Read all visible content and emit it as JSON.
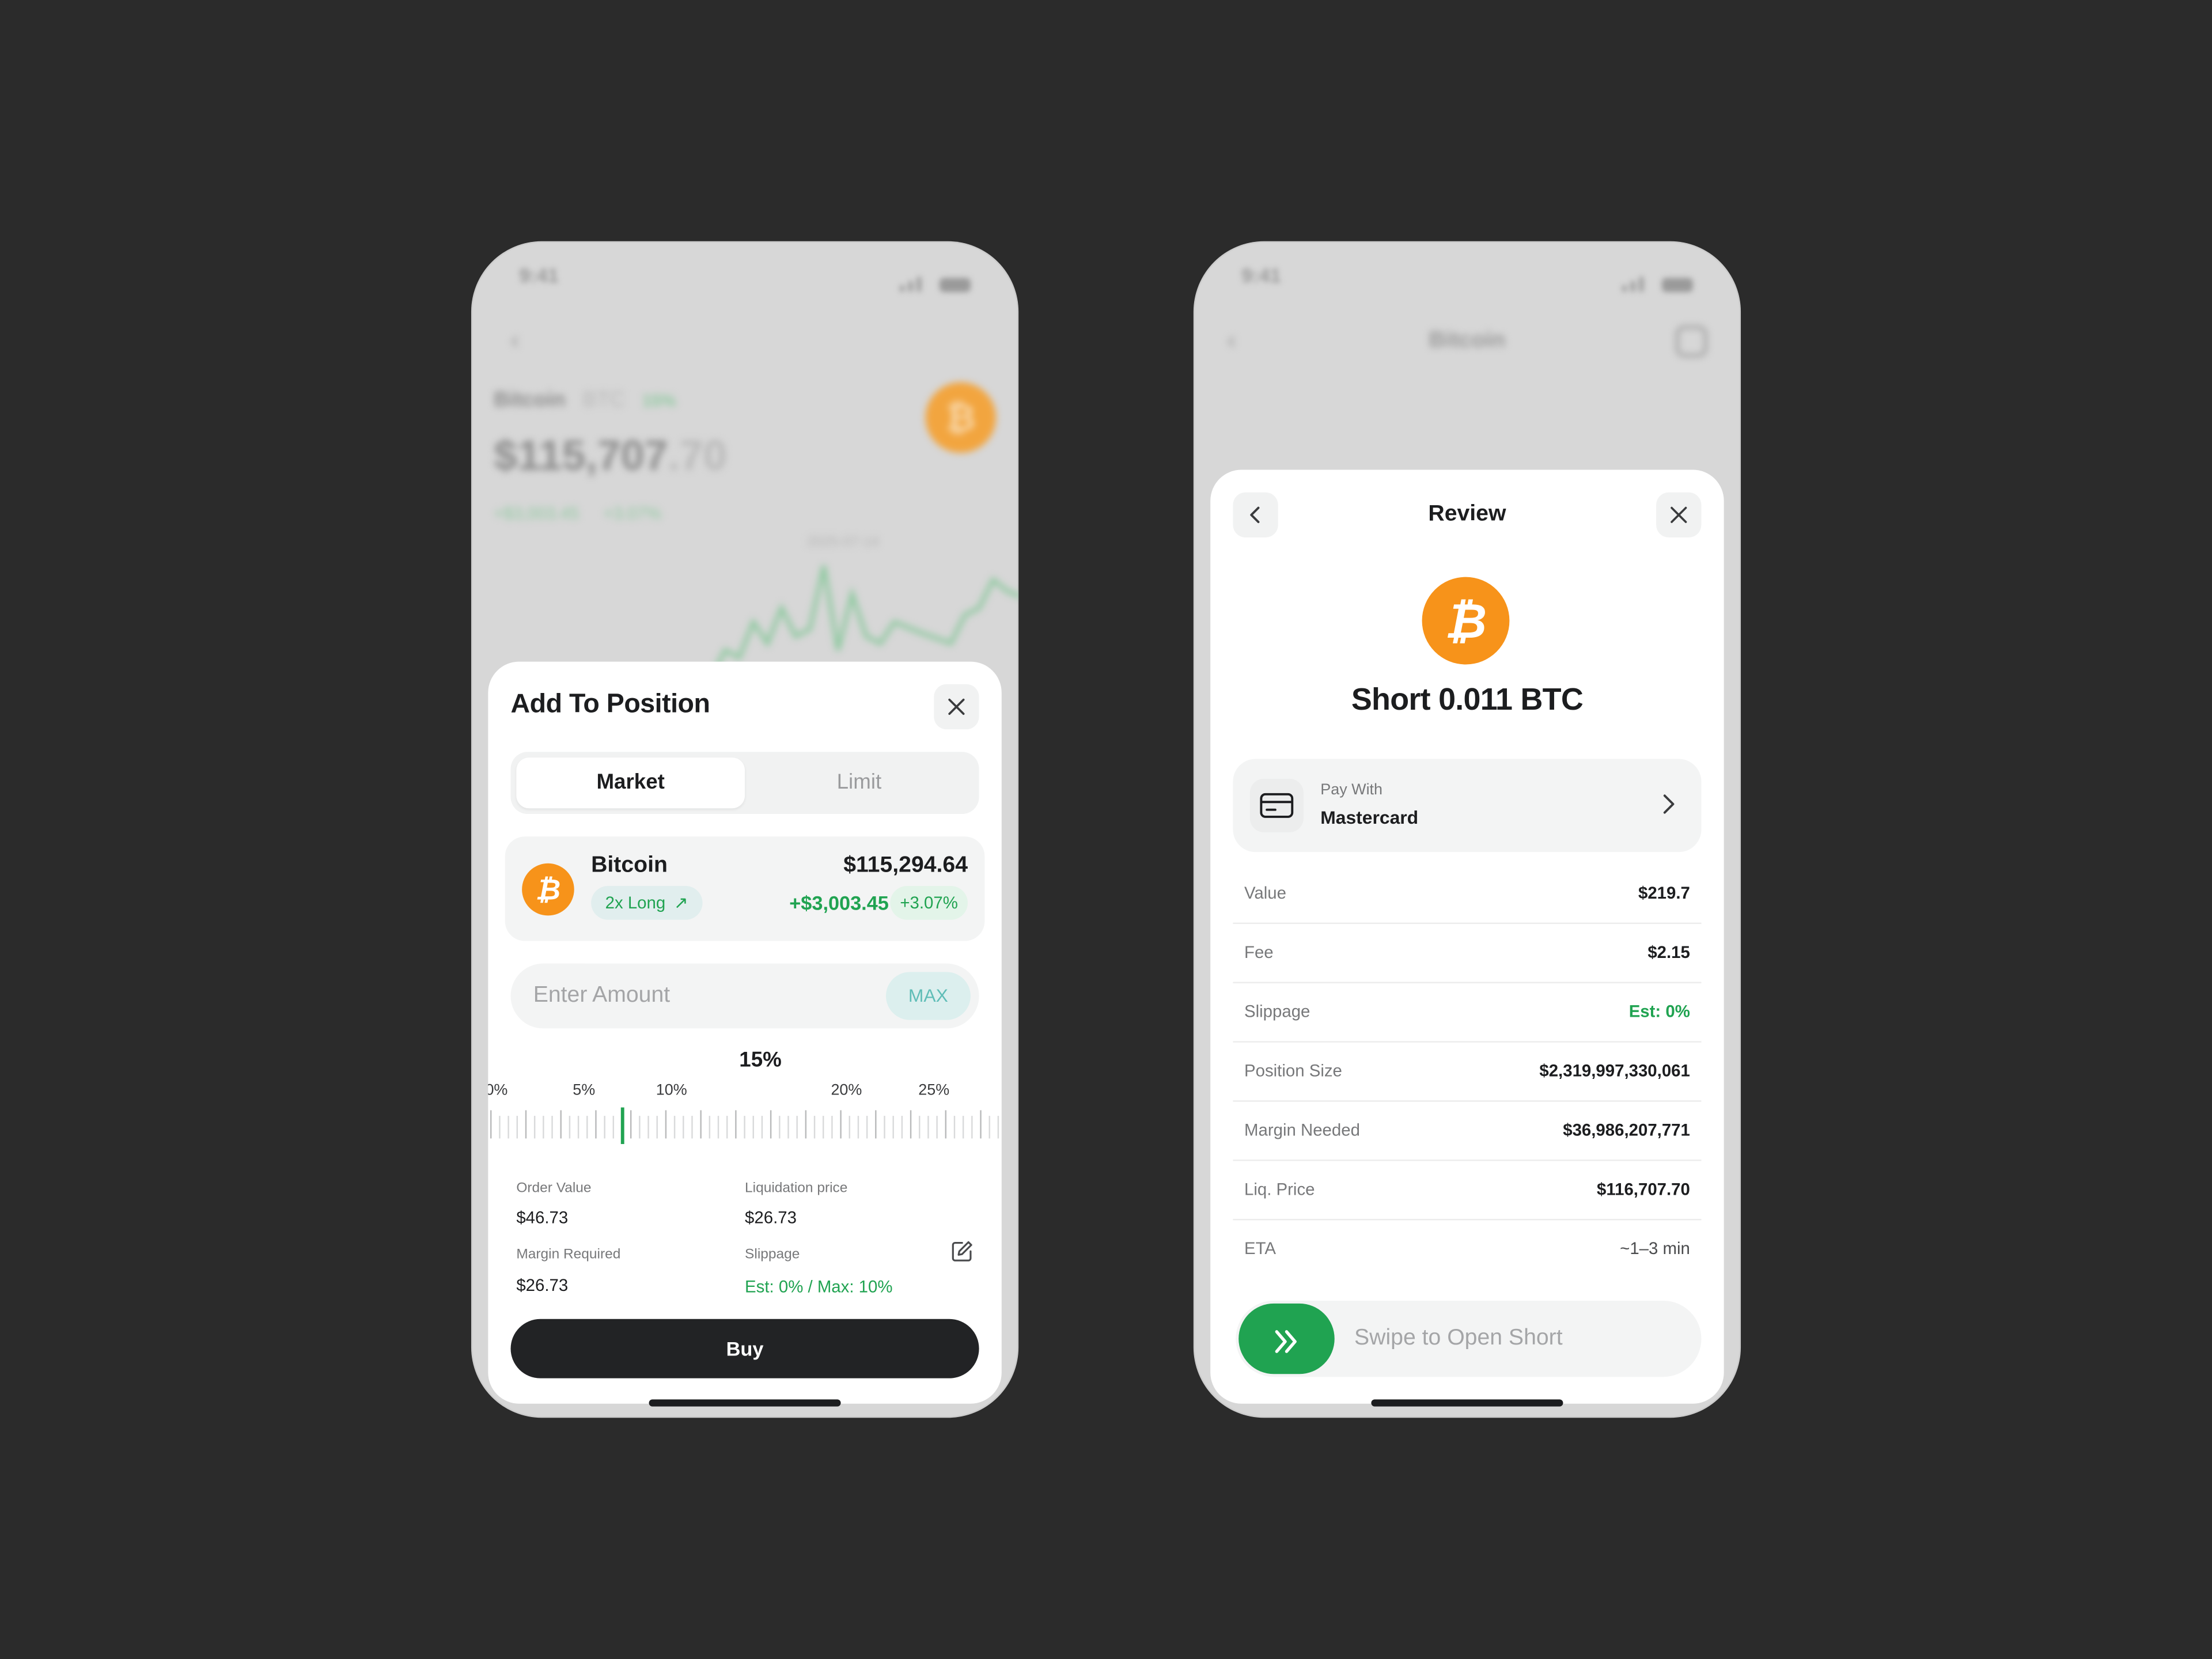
{
  "left_screen": {
    "background": {
      "status_time": "9:41",
      "asset_name": "Bitcoin",
      "asset_symbol": "BTC",
      "asset_change": "15%",
      "price_main": "$115,707",
      "price_decimals": ".70",
      "gain": "+$3,003.45",
      "gain_pct": "+3.07%",
      "chart_date": "2025-07-14"
    },
    "sheet": {
      "title": "Add To Position",
      "tabs": [
        {
          "label": "Market",
          "selected": true
        },
        {
          "label": "Limit",
          "selected": false
        }
      ],
      "asset": {
        "name": "Bitcoin",
        "leverage": "2x Long",
        "price": "$115,294.64",
        "change": "+$3,003.45",
        "change_pct": "+3.07%"
      },
      "amount": {
        "placeholder": "Enter Amount",
        "max_label": "MAX"
      },
      "slider": {
        "current_label": "15%",
        "current_value": 15,
        "min": 0,
        "max": 30,
        "ticks": [
          "0%",
          "5%",
          "10%",
          "20%",
          "25%"
        ]
      },
      "info": {
        "order_value_label": "Order Value",
        "order_value": "$46.73",
        "liquidation_label": "Liquidation price",
        "liquidation": "$26.73",
        "margin_label": "Margin Required",
        "margin": "$26.73",
        "slippage_label": "Slippage",
        "slippage": "Est: 0% / Max: 10%"
      },
      "buy_label": "Buy"
    }
  },
  "right_screen": {
    "background": {
      "status_time": "9:41",
      "header_title": "Bitcoin"
    },
    "sheet": {
      "title": "Review",
      "headline": "Short 0.011 BTC",
      "pay": {
        "label": "Pay With",
        "value": "Mastercard"
      },
      "rows": [
        {
          "label": "Value",
          "value": "$219.7"
        },
        {
          "label": "Fee",
          "value": "$2.15"
        },
        {
          "label": "Slippage",
          "value": "Est: 0%"
        },
        {
          "label": "Position Size",
          "value": "$2,319,997,330,061"
        },
        {
          "label": "Margin Needed",
          "value": "$36,986,207,771"
        },
        {
          "label": "Liq. Price",
          "value": "$116,707.70"
        },
        {
          "label": "ETA",
          "value": "~1–3 min"
        }
      ],
      "swipe_label": "Swipe to Open Short"
    }
  },
  "colors": {
    "background": "#2b2b2b",
    "accent_green": "#20a351",
    "bitcoin_orange": "#f7931a",
    "button_dark": "#222325"
  }
}
